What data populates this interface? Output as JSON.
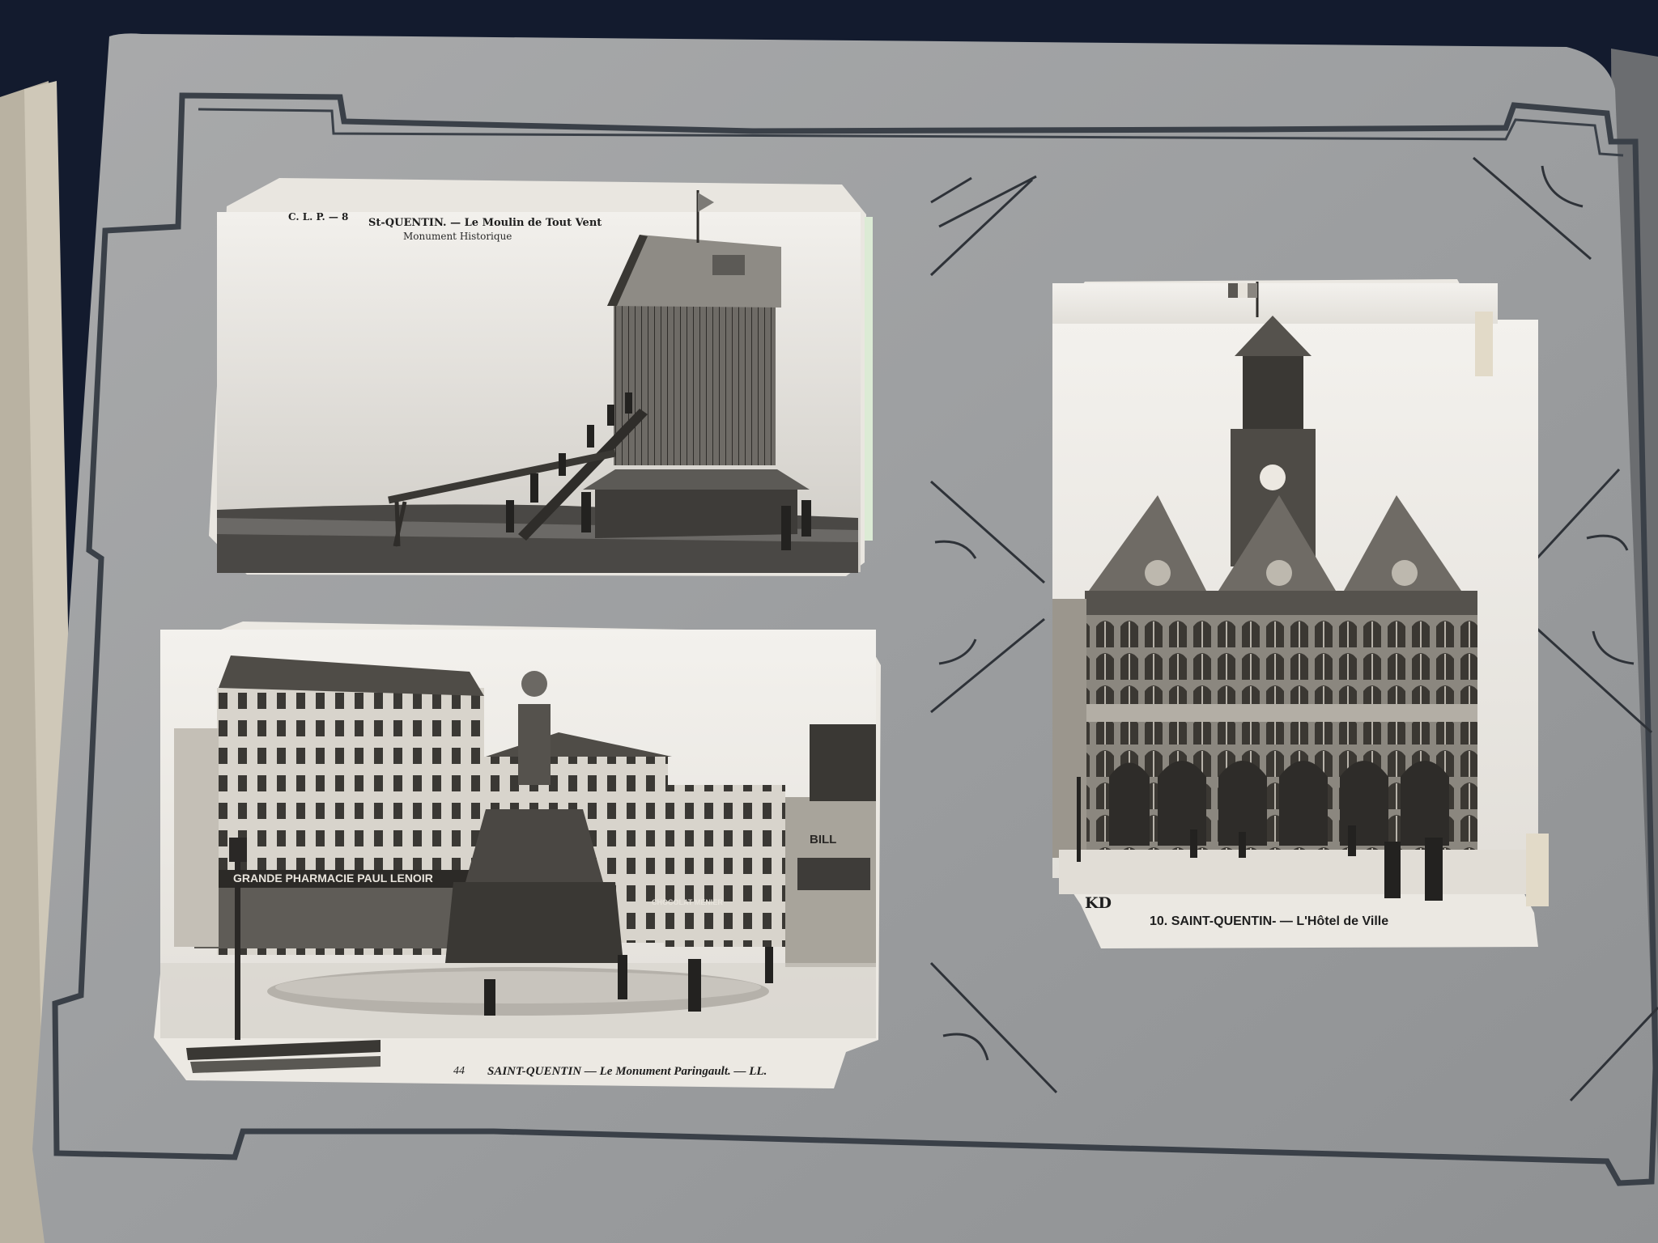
{
  "album": {
    "colors": {
      "page": "#9fa1a3",
      "page_edge": "#b5b3ab",
      "border_line": "#3a4048",
      "backdrop": "#131b2e",
      "photo_paper": "#ece8e1"
    }
  },
  "postcards": [
    {
      "subject": "windmill",
      "line1_prefix": "C. L. P. — 8",
      "line1_title": "St-QUENTIN. — Le Moulin de Tout Vent",
      "line2": "Monument Historique"
    },
    {
      "subject": "fountain-square",
      "shop_sign": "GRANDE PHARMACIE PAUL LENOIR",
      "side_sign": "BILL",
      "chocolat_sign": "CHOCOLAT MENIER",
      "caption_number": "44",
      "caption_title": "SAINT-QUENTIN — Le Monument Paringault. — LL."
    },
    {
      "subject": "town-hall",
      "publisher_mark": "KD",
      "caption_title": "10. SAINT-QUENTIN- — L'Hôtel de Ville"
    }
  ]
}
